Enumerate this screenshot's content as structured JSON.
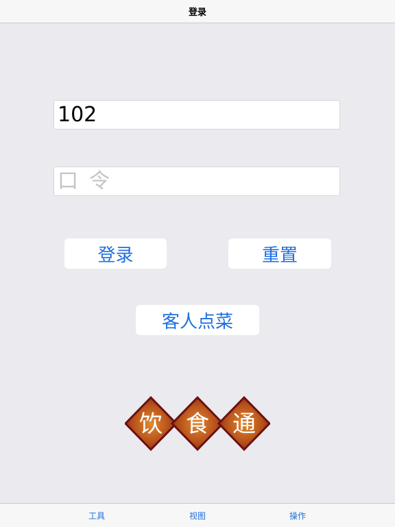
{
  "nav": {
    "title": "登录"
  },
  "login_form": {
    "username_value": "102",
    "password_placeholder": "口令",
    "login_label": "登录",
    "reset_label": "重置",
    "guest_order_label": "客人点菜"
  },
  "logo": {
    "chars": [
      "饮",
      "食",
      "通"
    ],
    "colors": {
      "diamond": "#b5421c",
      "border": "#6b1010",
      "text": "#ffffff"
    }
  },
  "tab_bar": {
    "items": [
      {
        "label": "工具"
      },
      {
        "label": "视图"
      },
      {
        "label": "操作"
      }
    ]
  },
  "colors": {
    "accent": "#1f6fe0",
    "background": "#eaeaef",
    "bar": "#f7f7f7"
  }
}
